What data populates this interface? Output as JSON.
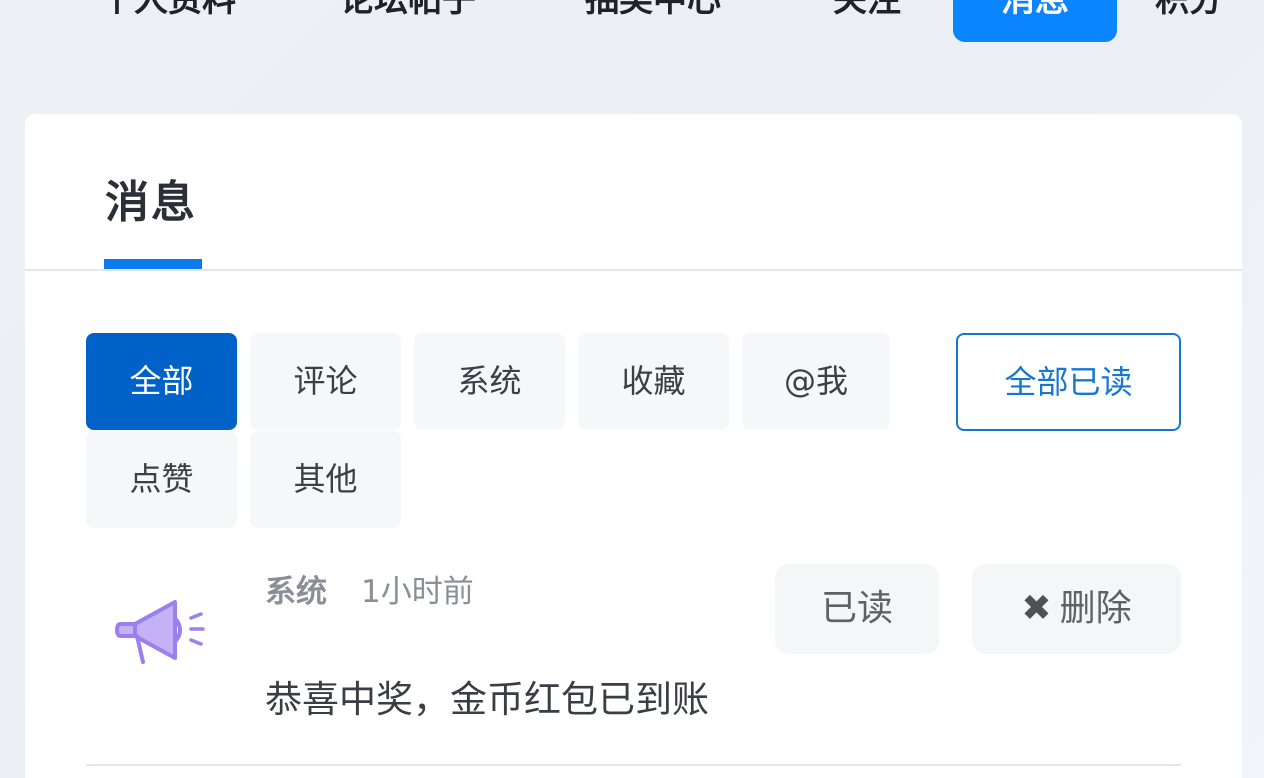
{
  "top_nav": {
    "items": [
      {
        "label": "个人资料",
        "active": false
      },
      {
        "label": "论坛帖子",
        "active": false
      },
      {
        "label": "抽奖中心",
        "active": false
      },
      {
        "label": "关注",
        "active": false
      },
      {
        "label": "消息",
        "active": true
      },
      {
        "label": "积分",
        "active": false
      }
    ]
  },
  "card": {
    "tab_label": "消息",
    "filters": [
      {
        "label": "全部",
        "active": true
      },
      {
        "label": "评论",
        "active": false
      },
      {
        "label": "系统",
        "active": false
      },
      {
        "label": "收藏",
        "active": false
      },
      {
        "label": "@我",
        "active": false
      },
      {
        "label": "点赞",
        "active": false
      },
      {
        "label": "其他",
        "active": false
      }
    ],
    "mark_all_read_label": "全部已读",
    "messages": [
      {
        "icon": "megaphone-icon",
        "source": "系统",
        "time": "1小时前",
        "body": "恭喜中奖，金币红包已到账",
        "read_label": "已读",
        "delete_label": "删除",
        "delete_icon": "close-icon"
      }
    ]
  },
  "colors": {
    "primary": "#0a84ff",
    "filter_active": "#0062c9",
    "outline_blue": "#1677d3",
    "icon_purple": "#a78bf0"
  }
}
